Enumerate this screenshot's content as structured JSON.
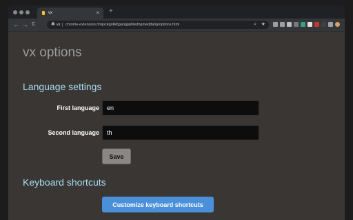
{
  "browser": {
    "tab": {
      "title": "vx",
      "close": "×"
    },
    "new_tab": "+",
    "nav": {
      "back": "←",
      "forward": "→",
      "reload": "C"
    },
    "omnibox": {
      "site_label": "vx",
      "url": "chrome-extension://mjockgnllkfjgahgpphledhgmedjfahg/options.html"
    },
    "extension_colors": [
      "#9aa0a6",
      "#9aa0a6",
      "#bdbdbd",
      "#7a7a7a",
      "#3aa17e",
      "#e0e0e0",
      "#c0392b",
      "#404040",
      "#9aa0a6",
      "#d9a06b"
    ]
  },
  "page": {
    "title": "vx options",
    "language_section": {
      "heading": "Language settings",
      "first_label": "First language",
      "first_value": "en",
      "second_label": "Second language",
      "second_value": "th",
      "save_label": "Save"
    },
    "shortcuts_section": {
      "heading": "Keyboard shortcuts",
      "button_label": "Customize keyboard shortcuts"
    }
  },
  "colors": {
    "page_bg": "#393633",
    "heading_accent": "#a8dcf0",
    "primary_button": "#4a90d9",
    "save_button": "#8b8785"
  }
}
